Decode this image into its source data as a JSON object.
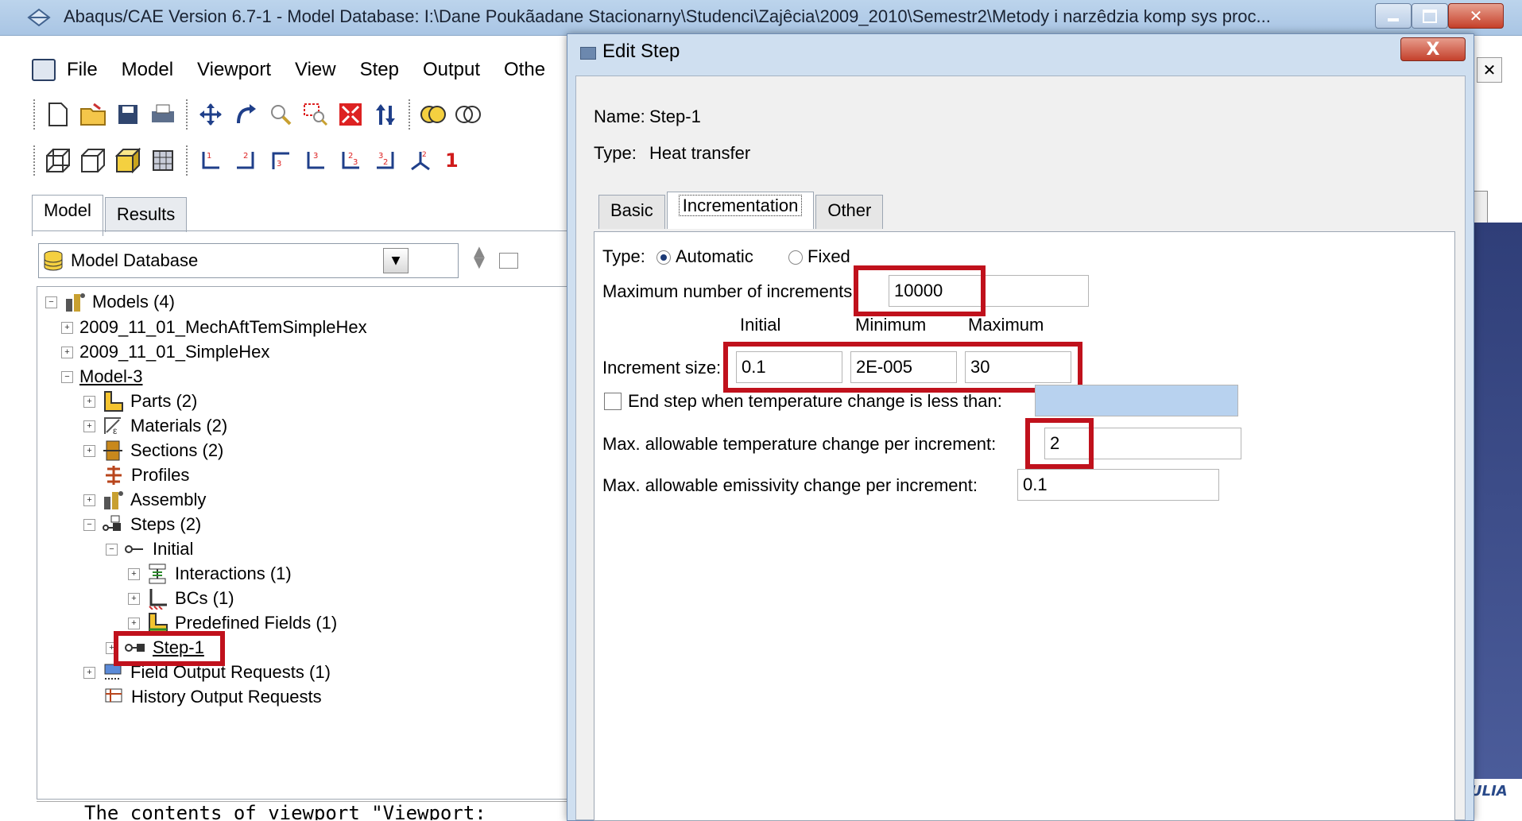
{
  "main_window": {
    "title": "Abaqus/CAE Version 6.7-1 - Model Database: I:\\Dane Poukãadane Stacionarny\\Studenci\\Zajêcia\\2009_2010\\Semestr2\\Metody i narzêdzia komp sys proc..."
  },
  "menubar": {
    "items": [
      "File",
      "Model",
      "Viewport",
      "View",
      "Step",
      "Output",
      "Othe"
    ]
  },
  "toolbar_row2": {
    "number_label": "1"
  },
  "left_tabs": [
    "Model",
    "Results"
  ],
  "model_db": {
    "label": "Model Database"
  },
  "tree": {
    "models": "Models (4)",
    "model_1": "2009_11_01_MechAftTemSimpleHex",
    "model_2": "2009_11_01_SimpleHex",
    "model_3": "Model-3",
    "parts": "Parts (2)",
    "materials": "Materials (2)",
    "sections": "Sections (2)",
    "profiles": "Profiles",
    "assembly": "Assembly",
    "steps": "Steps (2)",
    "initial": "Initial",
    "interactions": "Interactions (1)",
    "bcs": "BCs (1)",
    "predefined": "Predefined Fields (1)",
    "step1": "Step-1",
    "field_output": "Field Output Requests (1)",
    "history_output": "History Output Requests"
  },
  "message_area": {
    "text": "The contents of viewport \"Viewport:"
  },
  "right_logo": "ULIA",
  "dialog": {
    "title": "Edit Step",
    "close_glyph": "X",
    "name_label": "Name:",
    "name_value": "Step-1",
    "type_label": "Type:",
    "type_value": "Heat transfer",
    "tabs": [
      "Basic",
      "Incrementation",
      "Other"
    ],
    "incr": {
      "type_label": "Type:",
      "automatic": "Automatic",
      "fixed": "Fixed",
      "max_increments_label": "Maximum number of increments:",
      "max_increments_value": "10000",
      "col_initial": "Initial",
      "col_minimum": "Minimum",
      "col_maximum": "Maximum",
      "increment_size_label": "Increment size:",
      "initial_value": "0.1",
      "minimum_value": "2E-005",
      "maximum_value": "30",
      "end_step_label": "End step when temperature change is less than:",
      "max_temp_change_label": "Max. allowable temperature change per increment:",
      "max_temp_change_value": "2",
      "max_emissivity_label": "Max. allowable emissivity change per increment:",
      "max_emissivity_value": "0.1"
    }
  },
  "colors": {
    "highlight_red": "#c0111c",
    "title_bar": "#bcd4ec",
    "disabled_field_blue": "#b8d2ef"
  }
}
